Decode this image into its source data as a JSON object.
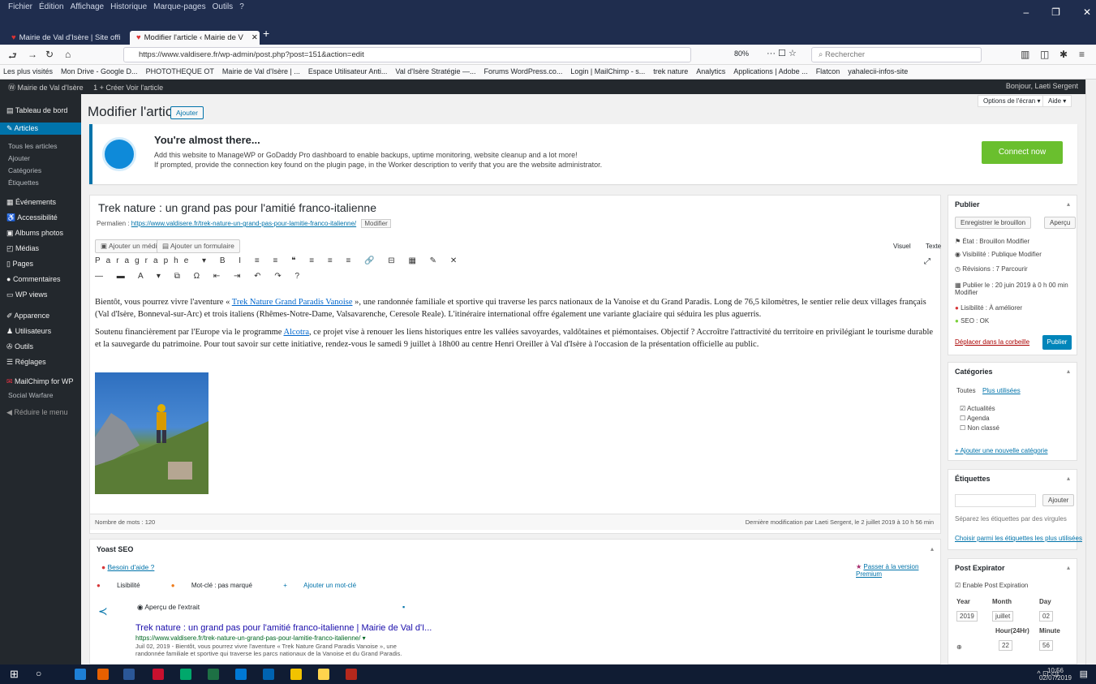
{
  "browser": {
    "menu": [
      "Fichier",
      "Édition",
      "Affichage",
      "Historique",
      "Marque-pages",
      "Outils",
      "?"
    ],
    "tabs": [
      {
        "title": "Mairie de Val d'Isère | Site offi"
      },
      {
        "title": "Modifier l'article ‹ Mairie de V"
      }
    ],
    "url": "https://www.valdisere.fr/wp-admin/post.php?post=151&action=edit",
    "zoom": "80%",
    "search_placeholder": "Rechercher",
    "bookmarks": [
      "Les plus visités",
      "Mon Drive - Google D...",
      "PHOTOTHEQUE OT",
      "Mairie de Val d'Isère | ...",
      "Espace Utilisateur Anti...",
      "Val d'Isère Stratégie —...",
      "Forums WordPress.co...",
      "Login | MailChimp - s...",
      "trek nature",
      "Analytics",
      "Applications | Adobe ...",
      "Flatcon",
      "yahalecii-infos-site"
    ]
  },
  "admin_bar": {
    "site": "Mairie de Val d'Isère",
    "items": "1  + Créer  Voir l'article",
    "greeting": "Bonjour, Laeti Sergent"
  },
  "sidebar": {
    "items": [
      {
        "label": "Tableau de bord"
      },
      {
        "label": "Articles"
      },
      {
        "label": "Tous les articles"
      },
      {
        "label": "Ajouter"
      },
      {
        "label": "Catégories"
      },
      {
        "label": "Étiquettes"
      },
      {
        "label": "Événements"
      },
      {
        "label": "Accessibilité"
      },
      {
        "label": "Albums photos"
      },
      {
        "label": "Médias"
      },
      {
        "label": "Pages"
      },
      {
        "label": "Commentaires"
      },
      {
        "label": "WP views"
      },
      {
        "label": "Apparence"
      },
      {
        "label": "Utilisateurs"
      },
      {
        "label": "Outils"
      },
      {
        "label": "Réglages"
      },
      {
        "label": "MailChimp for WP"
      },
      {
        "label": "Social Warfare"
      },
      {
        "label": "Réduire le menu"
      }
    ]
  },
  "page": {
    "title": "Modifier l'article",
    "add_button": "Ajouter",
    "screen_options": "Options de l'écran ▾",
    "help": "Aide ▾"
  },
  "notice": {
    "title": "You're almost there...",
    "line1": "Add this website to ManageWP or GoDaddy Pro dashboard to enable backups, uptime monitoring, website cleanup and a lot more!",
    "line2": "If prompted, provide the connection key found on the plugin page, in the Worker description to verify that you are the website administrator.",
    "button": "Connect now"
  },
  "post": {
    "title": "Trek nature : un grand pas pour l'amitié franco-italienne",
    "permalink_label": "Permalien :",
    "permalink_url": "https://www.valdisere.fr/trek-nature-un-grand-pas-pour-lamitie-franco-italienne/",
    "permalink_edit": "Modifier",
    "add_media": "Ajouter un média",
    "add_form": "Ajouter un formulaire",
    "tab_visual": "Visuel",
    "tab_text": "Texte",
    "toolbar_row1": "Paragraphe ▾ B I ≡ ≡ ❝ ≡ ≡ ≡ 🔗 ⊟ ▦ ✎ ✕",
    "toolbar_row2": "— ▬ A ▾ ⧉ Ω ⇤ ⇥ ↶ ↷ ?",
    "p1_before": "Bientôt, vous pourrez vivre l'aventure « ",
    "p1_link": "Trek Nature Grand Paradis Vanoise",
    "p1_after": " », une randonnée familiale et sportive qui traverse les parcs nationaux de la Vanoise et du Grand Paradis. Long de 76,5 kilomètres, le sentier relie deux villages français (Val d'Isère, Bonneval-sur-Arc) et trois italiens (Rhêmes-Notre-Dame, Valsavarenche, Ceresole Reale). L'itinéraire international offre également une variante glaciaire qui séduira les plus aguerris.",
    "p2_before": "Soutenu financièrement par l'Europe via le programme ",
    "p2_link": "Alcotra",
    "p2_after": ", ce projet vise à renouer les liens historiques entre les vallées savoyardes, valdôtaines et piémontaises. Objectif ? Accroître l'attractivité du territoire en privilégiant le tourisme durable et la sauvegarde du patrimoine. Pour tout savoir sur cette initiative, rendez-vous le samedi 9 juillet à 18h00 au centre Henri Oreiller à Val d'Isère à l'occasion de la présentation officielle au public.",
    "word_count": "Nombre de mots : 120",
    "last_modified": "Dernière modification par Laeti Sergent, le 2 juillet 2019 à 10 h 56 min"
  },
  "yoast": {
    "title": "Yoast SEO",
    "keyword": "Besoin d'aide ?",
    "premium": "Passer à la version Premium",
    "tabs": [
      "Lisibilité",
      "Mot-clé : pas marqué",
      "Ajouter un mot-clé"
    ],
    "snippet_header": "Aperçu de l'extrait",
    "snippet_title": "Trek nature : un grand pas pour l'amitié franco-italienne | Mairie de Val d'I...",
    "snippet_url": "https://www.valdisere.fr/trek-nature-un-grand-pas-pour-lamitie-franco-italienne/ ▾",
    "snippet_desc": "Juil 02, 2019 - Bientôt, vous pourrez vivre l'aventure « Trek Nature Grand Paradis Vanoise », une randonnée familiale et sportive qui traverse les parcs nationaux de la Vanoise et du Grand Paradis."
  },
  "publish": {
    "title": "Publier",
    "save_draft": "Enregistrer le brouillon",
    "preview": "Aperçu",
    "status": "État : Brouillon Modifier",
    "visibility": "Visibilité : Publique Modifier",
    "revisions": "Révisions : 7 Parcourir",
    "schedule": "Publier le : 20 juin 2019 à 0 h 00 min Modifier",
    "readability": "Lisibilité : À améliorer",
    "seo": "SEO : OK",
    "trash": "Déplacer dans la corbeille",
    "publish_btn": "Publier"
  },
  "categories": {
    "title": "Catégories",
    "tab_all": "Toutes",
    "tab_most_used": "Plus utilisées",
    "items": [
      "Actualités",
      "Agenda",
      "Non classé"
    ],
    "add_new": "+ Ajouter une nouvelle catégorie"
  },
  "tags": {
    "title": "Étiquettes",
    "add": "Ajouter",
    "hint": "Séparez les étiquettes par des virgules",
    "choose": "Choisir parmi les étiquettes les plus utilisées"
  },
  "post_expirator": {
    "title": "Post Expirator",
    "enable": "Enable Post Expiration",
    "labels": [
      "Year",
      "Month",
      "Day"
    ],
    "values": [
      "2019",
      "juillet",
      "02"
    ],
    "hour_label": "Hour(24Hr)",
    "minute_label": "Minute",
    "hour_value": "22",
    "minute_value": "56"
  },
  "taskbar": {
    "tray": "^ ⊡ ◁)",
    "time": "10:56",
    "date": "02/07/2019"
  },
  "colors": {
    "wp_admin_dark": "#23282d",
    "wp_blue": "#0073aa",
    "connect_green": "#6abf2e",
    "titlebar": "#1f2d4e"
  }
}
